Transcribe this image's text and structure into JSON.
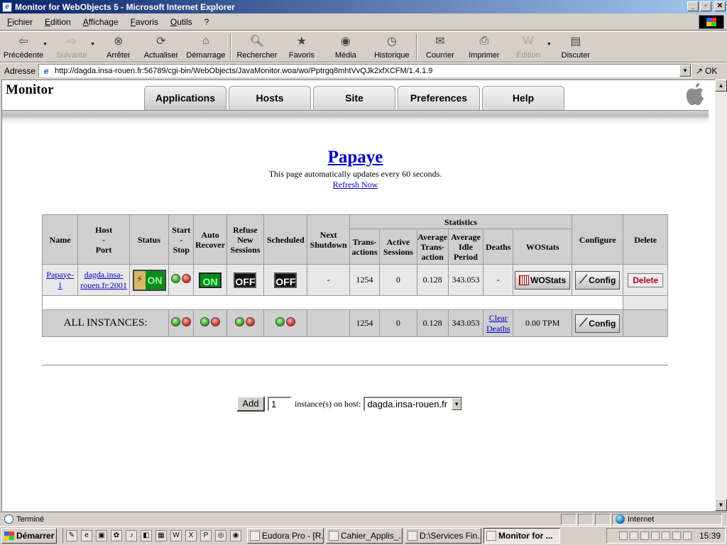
{
  "window": {
    "title": "Monitor for WebObjects 5 - Microsoft Internet Explorer"
  },
  "menu": [
    "Fichier",
    "Edition",
    "Affichage",
    "Favoris",
    "Outils",
    "?"
  ],
  "toolbar": {
    "back": "Précédente",
    "forward": "Suivante",
    "stop": "Arrêter",
    "refresh": "Actualiser",
    "home": "Démarrage",
    "search": "Rechercher",
    "favorites": "Favoris",
    "media": "Média",
    "history": "Historique",
    "mail": "Courrier",
    "print": "Imprimer",
    "edit": "Édition",
    "discuss": "Discuter"
  },
  "address": {
    "label": "Adresse",
    "url": "http://dagda.insa-rouen.fr:56789/cgi-bin/WebObjects/JavaMonitor.woa/wo/Pptrgq8mhtVvQJk2xfXCFM/1.4.1.9",
    "go": "OK"
  },
  "page": {
    "brand": "Monitor",
    "tabs": [
      "Applications",
      "Hosts",
      "Site",
      "Preferences",
      "Help"
    ],
    "app_name": "Papaye",
    "auto_update": "This page automatically updates every 60 seconds.",
    "refresh_now": "Refresh Now"
  },
  "table": {
    "headers": {
      "name": "Name",
      "host": "Host",
      "dash": "-",
      "port": "Port",
      "status": "Status",
      "start": "Start",
      "stop": "Stop",
      "auto": "Auto",
      "recover": "Recover",
      "refuse": "Refuse",
      "new": "New",
      "sessions": "Sessions",
      "scheduled": "Scheduled",
      "next": "Next",
      "shutdown": "Shutdown",
      "statistics": "Statistics",
      "trans1": "Trans-",
      "trans2": "actions",
      "active1": "Active",
      "active2": "Sessions",
      "avg1": "Average",
      "avg2": "Trans-",
      "avg3": "action",
      "idle1": "Average",
      "idle2": "Idle",
      "idle3": "Period",
      "deaths": "Deaths",
      "wostats": "WOStats",
      "configure": "Configure",
      "delete": "Delete"
    },
    "instance": {
      "name_a": "Papaye-",
      "name_b": "1",
      "host_a": "dagda.insa-",
      "host_b": "rouen.fr:2001",
      "status": "ON",
      "auto_recover": "ON",
      "refuse_new": "OFF",
      "scheduled": "OFF",
      "next_shutdown": "-",
      "transactions": "1254",
      "active_sessions": "0",
      "avg_transaction": "0.128",
      "avg_idle": "343.053",
      "deaths": "-",
      "wostats": "WOStats",
      "config": "Config",
      "delete": "Delete"
    },
    "all": {
      "label": "ALL INSTANCES:",
      "transactions": "1254",
      "active_sessions": "0",
      "avg_transaction": "0.128",
      "avg_idle": "343.053",
      "clear_a": "Clear",
      "clear_b": "Deaths",
      "tpm": "0.00 TPM",
      "config": "Config"
    }
  },
  "add": {
    "button": "Add",
    "count": "1",
    "label": "instance(s) on host:",
    "host": "dagda.insa-rouen.fr"
  },
  "statusbar": {
    "message": "Terminé",
    "zone": "Internet"
  },
  "taskbar": {
    "start": "Démarrer",
    "tasks": [
      "Eudora Pro - [R...",
      "Cahier_Applis_...",
      "D:\\Services Fin...",
      "Monitor for ..."
    ],
    "clock": "15:39"
  }
}
